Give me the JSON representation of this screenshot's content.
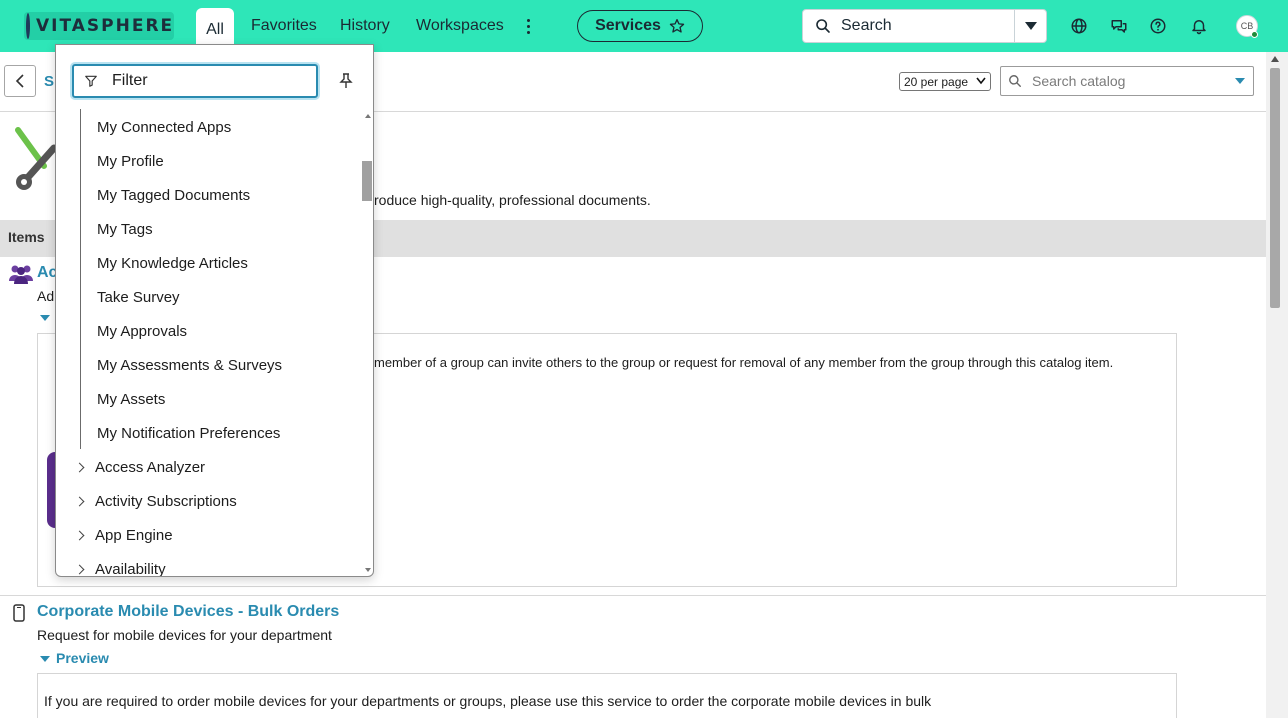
{
  "header": {
    "logo_text": "VITASPHERE",
    "nav": {
      "all": "All",
      "favorites": "Favorites",
      "history": "History",
      "workspaces": "Workspaces"
    },
    "services_label": "Services",
    "search_label": "Search",
    "avatar_initials": "CB",
    "accent_color": "#2ee6b8"
  },
  "subheader": {
    "crumb_fragment": "S",
    "per_page_value": "20 per page",
    "catalog_search_placeholder": "Search catalog"
  },
  "menu": {
    "filter_placeholder": "Filter",
    "sub_items": [
      "My Connected Apps",
      "My Profile",
      "My Tagged Documents",
      "My Tags",
      "My Knowledge Articles",
      "Take Survey",
      "My Approvals",
      "My Assessments & Surveys",
      "My Assets",
      "My Notification Preferences"
    ],
    "modules": [
      "Access Analyzer",
      "Activity Subscriptions",
      "App Engine",
      "Availability"
    ]
  },
  "content": {
    "category_description_fragment": "roduce high-quality, professional documents.",
    "items_label": "Items",
    "item1_title_fragment": "Ac",
    "item1_desc_fragment": "Ad",
    "item1_preview_fragment": "member of a group can invite others to the group or request for removal of any member from the group through this catalog item.",
    "item2_title": "Corporate Mobile Devices - Bulk Orders",
    "item2_desc": "Request for mobile devices for your department",
    "item2_preview_label": "Preview",
    "item2_preview_text": "If you are required to order mobile devices for your departments or groups, please use this service to order the corporate mobile devices in bulk"
  }
}
